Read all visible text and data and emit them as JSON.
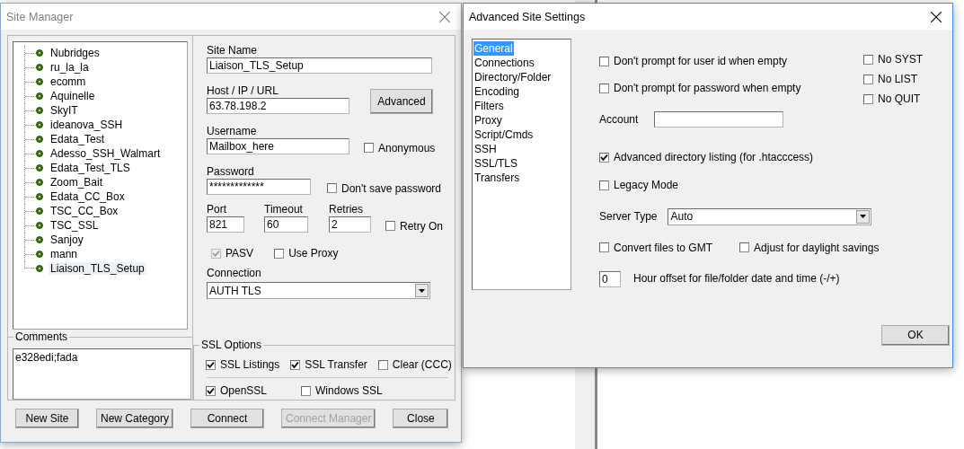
{
  "site_manager": {
    "title": "Site Manager",
    "sites": [
      {
        "label": "Nubridges",
        "selected": false
      },
      {
        "label": "ru_la_la",
        "selected": false
      },
      {
        "label": "ecomm",
        "selected": false
      },
      {
        "label": "Aquinelle",
        "selected": false
      },
      {
        "label": "SkyIT",
        "selected": false
      },
      {
        "label": "ideanova_SSH",
        "selected": false
      },
      {
        "label": "Edata_Test",
        "selected": false
      },
      {
        "label": "Adesso_SSH_Walmart",
        "selected": false
      },
      {
        "label": "Edata_Test_TLS",
        "selected": false
      },
      {
        "label": "Zoom_Bait",
        "selected": false
      },
      {
        "label": "Edata_CC_Box",
        "selected": false
      },
      {
        "label": "TSC_CC_Box",
        "selected": false
      },
      {
        "label": "TSC_SSL",
        "selected": false
      },
      {
        "label": "Sanjoy",
        "selected": false
      },
      {
        "label": "mann",
        "selected": false
      },
      {
        "label": "Liaison_TLS_Setup",
        "selected": true
      }
    ],
    "comments": {
      "label": "Comments",
      "value": "e328edi;fada"
    },
    "site_name": {
      "label": "Site Name",
      "value": "Liaison_TLS_Setup"
    },
    "host": {
      "label": "Host / IP / URL",
      "value": "63.78.198.2"
    },
    "advanced_button": "Advanced",
    "username": {
      "label": "Username",
      "value": "Mailbox_here"
    },
    "anonymous": {
      "label": "Anonymous",
      "checked": false
    },
    "password": {
      "label": "Password",
      "value": "*************"
    },
    "dont_save_password": {
      "label": "Don't save password",
      "checked": false
    },
    "port": {
      "label": "Port",
      "value": "821"
    },
    "timeout": {
      "label": "Timeout",
      "value": "60"
    },
    "retries": {
      "label": "Retries",
      "value": "2"
    },
    "retry_on": {
      "label": "Retry On",
      "checked": false
    },
    "pasv": {
      "label": "PASV",
      "checked": true,
      "disabled": true
    },
    "use_proxy": {
      "label": "Use Proxy",
      "checked": false
    },
    "connection": {
      "label": "Connection",
      "value": "AUTH TLS"
    },
    "ssl_options": {
      "label": "SSL Options",
      "row_1": [
        {
          "label": "SSL Listings",
          "checked": true
        },
        {
          "label": "SSL Transfer",
          "checked": true
        },
        {
          "label": "Clear (CCC)",
          "checked": false
        }
      ],
      "row_2": [
        {
          "label": "OpenSSL",
          "checked": true
        },
        {
          "label": "Windows SSL",
          "checked": false
        }
      ]
    },
    "buttons": [
      {
        "label": "New Site",
        "disabled": false
      },
      {
        "label": "New Category",
        "disabled": false
      },
      {
        "label": "Connect",
        "disabled": false
      },
      {
        "label": "Connect Manager",
        "disabled": true
      },
      {
        "label": "Close",
        "disabled": false
      }
    ]
  },
  "advanced": {
    "title": "Advanced Site Settings",
    "nav": [
      {
        "label": "General",
        "selected": true
      },
      {
        "label": "Connections",
        "selected": false
      },
      {
        "label": "Directory/Folder",
        "selected": false
      },
      {
        "label": "Encoding",
        "selected": false
      },
      {
        "label": "Filters",
        "selected": false
      },
      {
        "label": "Proxy",
        "selected": false
      },
      {
        "label": "Script/Cmds",
        "selected": false
      },
      {
        "label": "SSH",
        "selected": false
      },
      {
        "label": "SSL/TLS",
        "selected": false
      },
      {
        "label": "Transfers",
        "selected": false
      }
    ],
    "prompt_options": [
      {
        "label": "Don't prompt for user id when empty",
        "checked": false
      },
      {
        "label": "Don't prompt for password when empty",
        "checked": false
      }
    ],
    "no_options": [
      {
        "label": "No SYST",
        "checked": false
      },
      {
        "label": "No LIST",
        "checked": false
      },
      {
        "label": "No QUIT",
        "checked": false
      }
    ],
    "account": {
      "label": "Account"
    },
    "advanced_listing": {
      "label": "Advanced directory listing (for .htacccess)",
      "checked": true
    },
    "legacy_mode": {
      "label": "Legacy Mode",
      "checked": false
    },
    "server_type": {
      "label": "Server Type",
      "value": "Auto"
    },
    "convert_gmt": {
      "label": "Convert files to GMT",
      "checked": false
    },
    "daylight": {
      "label": "Adjust for daylight savings",
      "checked": false
    },
    "hour_offset": {
      "label": "Hour offset for file/folder date and time (-/+)",
      "value": "0"
    },
    "ok_button": "OK"
  }
}
